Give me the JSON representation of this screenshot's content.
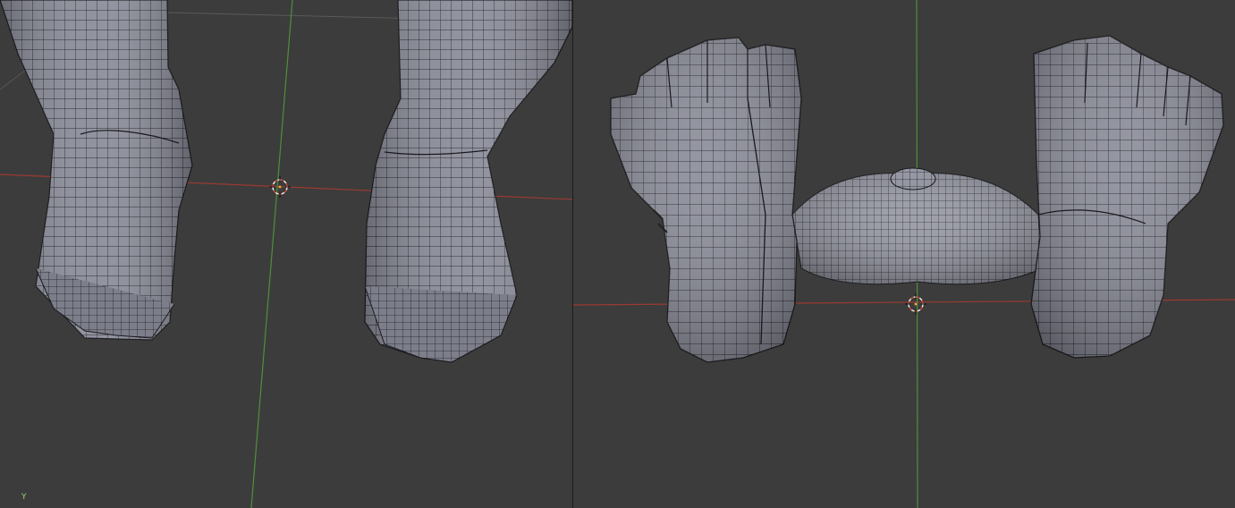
{
  "editor": "3D Viewport",
  "viewports": [
    {
      "name": "left-viewport",
      "view": "perspective"
    },
    {
      "name": "right-viewport",
      "view": "perspective"
    }
  ],
  "colors": {
    "background": "#3c3c3c",
    "mesh_face": "#8a8c99",
    "mesh_edge": "#202024",
    "x_axis": "#9b3a32",
    "y_axis": "#4f8f3a",
    "cursor": "#e8e8e8",
    "cursor_accent": "#d0442c"
  },
  "icons": {
    "cursor": "3d-cursor-icon",
    "gizmo": "axis-gizmo-icon"
  },
  "gizmo_label": "Y"
}
